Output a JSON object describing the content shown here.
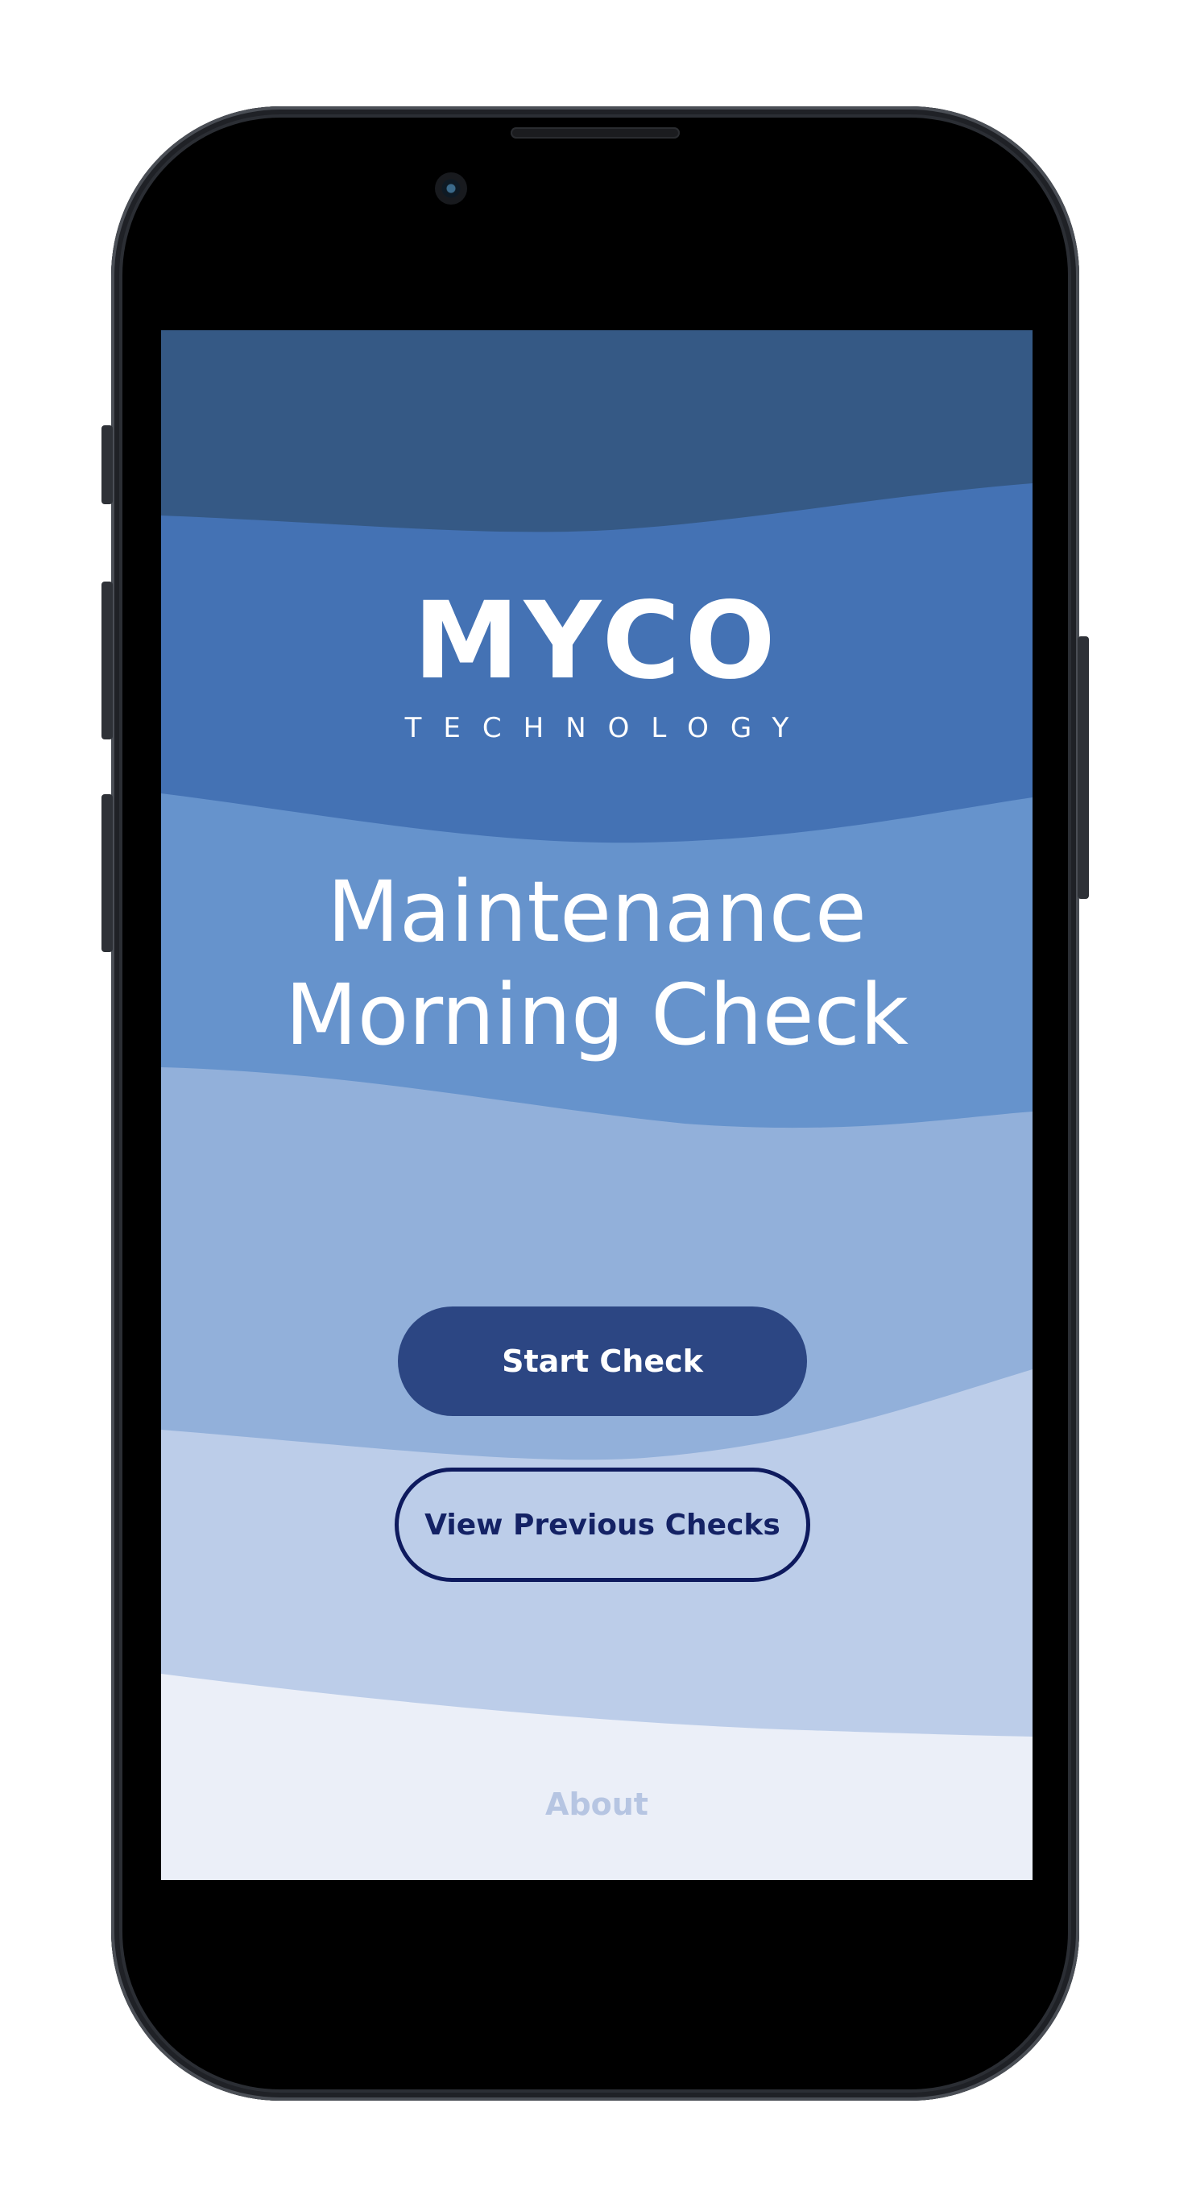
{
  "app": {
    "logo_main": "MYCO",
    "logo_sub": "TECHNOLOGY"
  },
  "main": {
    "title_line1": "Maintenance",
    "title_line2": "Morning Check"
  },
  "actions": {
    "start_label": "Start Check",
    "view_previous_label": "View Previous Checks"
  },
  "footer": {
    "about_label": "About"
  },
  "colors": {
    "band_top": "#355985",
    "band_2": "#4472b4",
    "band_3": "#6693cc",
    "band_4": "#92b0da",
    "band_5": "#bccde9",
    "band_bottom": "#ebeff8",
    "primary_button": "#2c4683",
    "secondary_button_border": "#0e1a5e",
    "about_text": "#b6c5e2"
  }
}
